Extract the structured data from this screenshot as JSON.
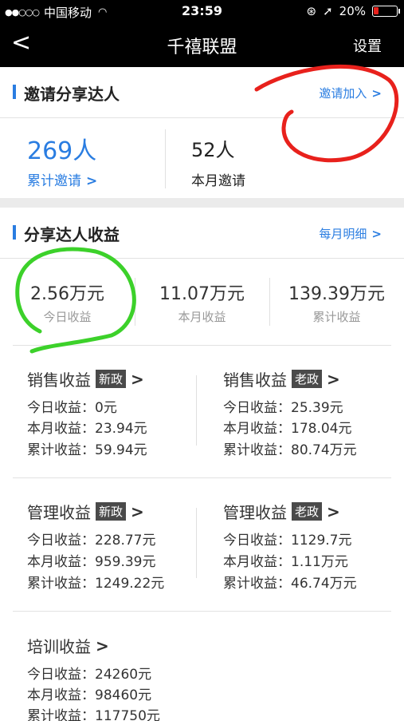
{
  "status": {
    "carrier": "中国移动",
    "time": "23:59",
    "battery": "20%",
    "battery_level": 0.2
  },
  "nav": {
    "title": "千禧联盟",
    "settings": "设置"
  },
  "invite": {
    "heading": "邀请分享达人",
    "join_link": "邀请加入",
    "total_value": "269人",
    "total_label": "累计邀请",
    "month_value": "52人",
    "month_label": "本月邀请"
  },
  "earnings": {
    "heading": "分享达人收益",
    "monthly_link": "每月明细",
    "summary": [
      {
        "value": "2.56万元",
        "label": "今日收益"
      },
      {
        "value": "11.07万元",
        "label": "本月收益"
      },
      {
        "value": "139.39万元",
        "label": "累计收益"
      }
    ],
    "blocks": [
      {
        "title": "销售收益",
        "tag": "新政",
        "rows": [
          {
            "label": "今日收益：",
            "value": "0元"
          },
          {
            "label": "本月收益：",
            "value": "23.94元"
          },
          {
            "label": "累计收益：",
            "value": "59.94元"
          }
        ]
      },
      {
        "title": "销售收益",
        "tag": "老政",
        "rows": [
          {
            "label": "今日收益：",
            "value": "25.39元"
          },
          {
            "label": "本月收益：",
            "value": "178.04元"
          },
          {
            "label": "累计收益：",
            "value": "80.74万元"
          }
        ]
      },
      {
        "title": "管理收益",
        "tag": "新政",
        "rows": [
          {
            "label": "今日收益：",
            "value": "228.77元"
          },
          {
            "label": "本月收益：",
            "value": "959.39元"
          },
          {
            "label": "累计收益：",
            "value": "1249.22元"
          }
        ]
      },
      {
        "title": "管理收益",
        "tag": "老政",
        "rows": [
          {
            "label": "今日收益：",
            "value": "1129.7元"
          },
          {
            "label": "本月收益：",
            "value": "1.11万元"
          },
          {
            "label": "累计收益：",
            "value": "46.74万元"
          }
        ]
      },
      {
        "title": "培训收益",
        "tag": "",
        "rows": [
          {
            "label": "今日收益：",
            "value": "24260元"
          },
          {
            "label": "本月收益：",
            "value": "98460元"
          },
          {
            "label": "累计收益：",
            "value": "117750元"
          }
        ]
      }
    ]
  },
  "colors": {
    "accent": "#2a7de1",
    "annotation_red": "#e8211c",
    "annotation_green": "#3cd12a"
  }
}
